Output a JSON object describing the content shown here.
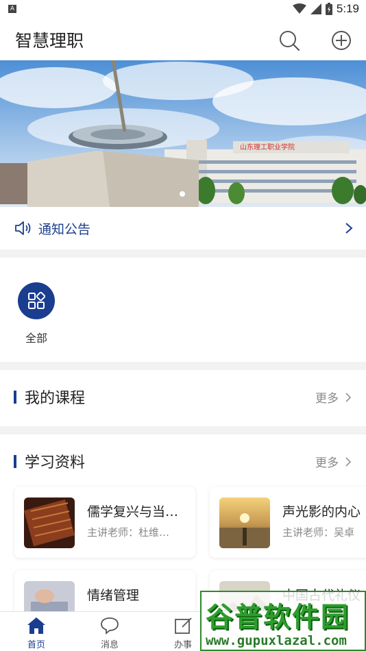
{
  "status_bar": {
    "sim_label": "A",
    "time": "5:19"
  },
  "header": {
    "title": "智慧理职"
  },
  "banner": {
    "sign_text": "山东理工职业学院"
  },
  "notice": {
    "label": "通知公告"
  },
  "apps": [
    {
      "label": "全部"
    }
  ],
  "courses": {
    "title": "我的课程",
    "more": "更多"
  },
  "materials": {
    "title": "学习资料",
    "more": "更多",
    "items": [
      {
        "title": "儒学复兴与当…",
        "teacher": "主讲老师：杜维…"
      },
      {
        "title": "声光影的内心",
        "teacher": "主讲老师：吴卓"
      },
      {
        "title": "情绪管理",
        "teacher": ""
      },
      {
        "title": "中国古代礼仪",
        "teacher": ""
      }
    ]
  },
  "tabbar": {
    "tabs": [
      {
        "label": "首页"
      },
      {
        "label": "消息"
      },
      {
        "label": "办事"
      }
    ]
  },
  "watermark": {
    "main": "谷普软件园",
    "url": "www.gupuxlazal.com"
  },
  "colors": {
    "brand": "#1a3d8f",
    "accent_text": "#1c3f8c",
    "muted": "#888888"
  }
}
